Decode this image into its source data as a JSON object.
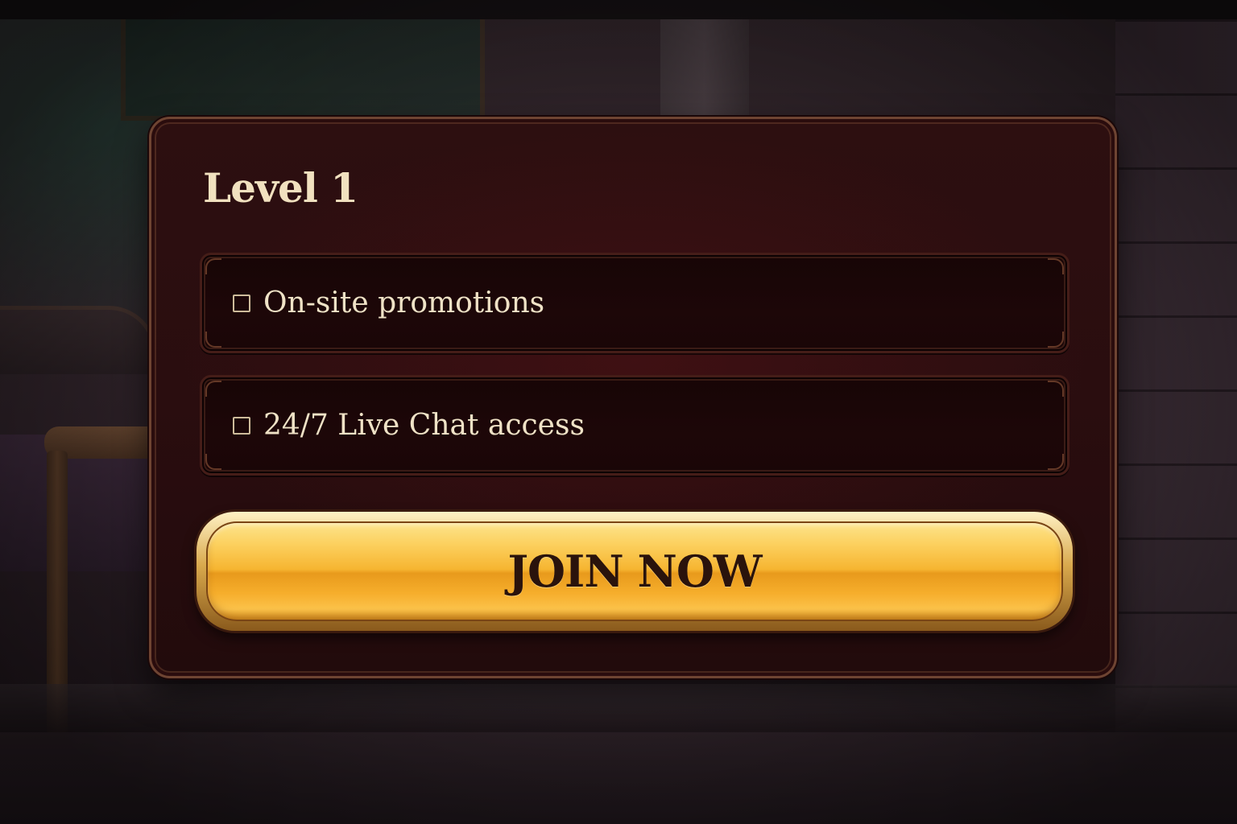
{
  "panel": {
    "title": "Level 1",
    "benefits": [
      {
        "label": "On-site promotions",
        "checked": false
      },
      {
        "label": "24/7 Live Chat access",
        "checked": false
      }
    ],
    "join_label": "JOIN NOW"
  },
  "colors": {
    "panel_background": "#2a0d0f",
    "panel_border": "#6e4432",
    "text": "#efe2c6",
    "button_gold": "#f6b531",
    "button_text": "#2a130c"
  }
}
